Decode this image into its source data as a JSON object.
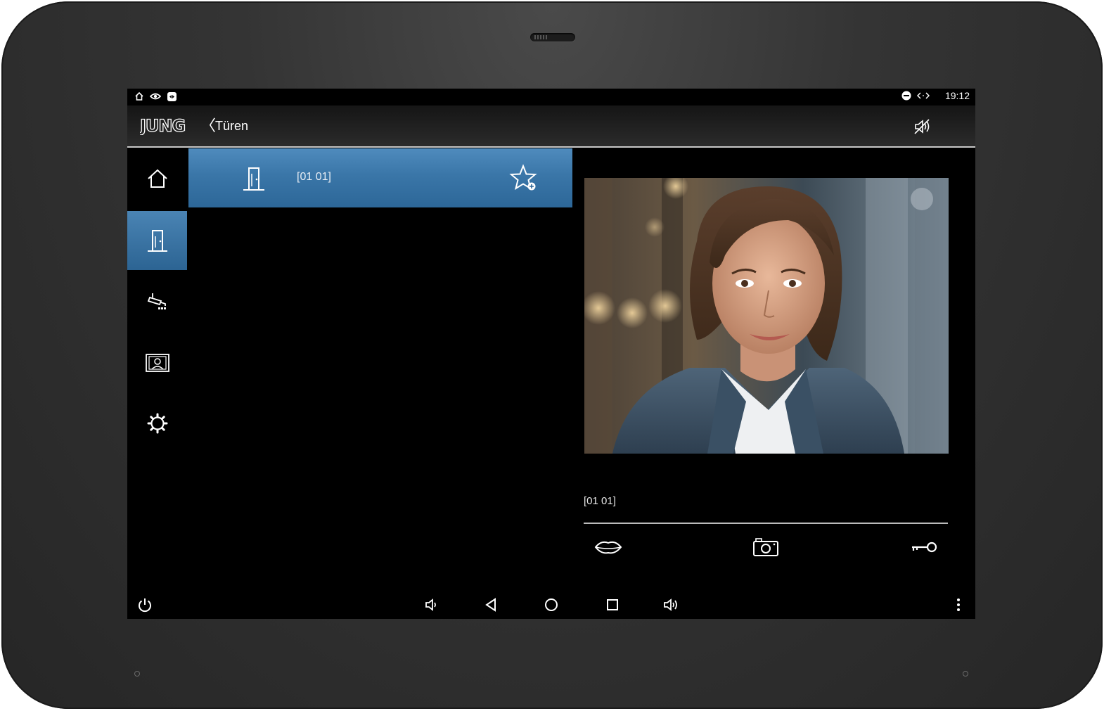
{
  "status_bar": {
    "time": "19:12",
    "left_icons": [
      "home-icon",
      "eye-icon",
      "remote-icon"
    ],
    "right_icons": [
      "do-not-disturb-icon",
      "code-arrows-icon"
    ]
  },
  "header": {
    "logo_text": "JUNG",
    "back_symbol": "〈",
    "title": "Türen",
    "right_icon": "mute-speaker-icon"
  },
  "sidebar": {
    "items": [
      {
        "name": "home",
        "icon": "home-icon",
        "active": false
      },
      {
        "name": "doors",
        "icon": "door-icon",
        "active": true
      },
      {
        "name": "cameras",
        "icon": "camera-surveillance-icon",
        "active": false
      },
      {
        "name": "contacts",
        "icon": "contact-card-icon",
        "active": false
      },
      {
        "name": "settings",
        "icon": "gear-icon",
        "active": false
      }
    ]
  },
  "door_list": {
    "items": [
      {
        "label": "[01 01]",
        "icon": "door-icon",
        "action_icon": "star-add-icon",
        "selected": true
      }
    ]
  },
  "video_panel": {
    "caller_label": "[01 01]",
    "actions": [
      {
        "name": "talk",
        "icon": "lips-icon"
      },
      {
        "name": "snapshot",
        "icon": "photo-camera-icon"
      },
      {
        "name": "open-door",
        "icon": "key-icon"
      }
    ]
  },
  "android_nav": {
    "buttons": [
      "power-icon",
      "volume-down-icon",
      "back-icon",
      "home-circle-icon",
      "recents-icon",
      "volume-up-icon",
      "more-vert-icon"
    ]
  },
  "colors": {
    "accent": "#3a76a8",
    "bezel": "#2f2f2f",
    "screen": "#000000"
  }
}
